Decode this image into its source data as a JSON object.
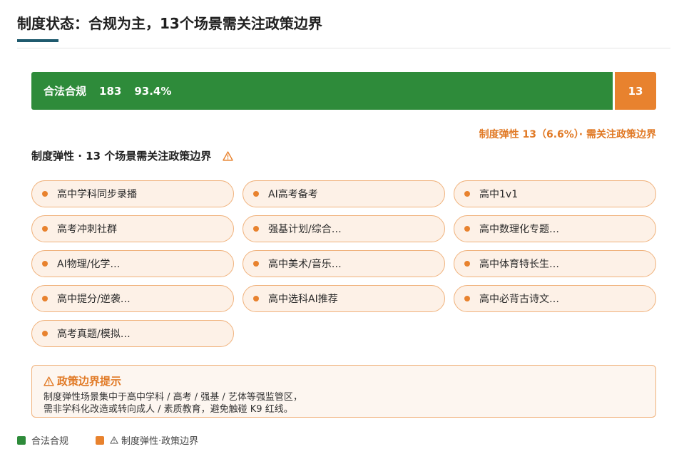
{
  "header": {
    "title": "制度状态：合规为主，13个场景需关注政策边界"
  },
  "status_bar": {
    "compliant_label": "合法合规",
    "compliant_count": "183",
    "compliant_pct": "93.4%",
    "flex_count": "13",
    "compliant_value": 183,
    "flex_value": 13,
    "compliant_color": "#2e8b3a",
    "flex_color": "#e8822e"
  },
  "flex_note": "制度弹性 13（6.6%）· 需关注政策边界",
  "section": {
    "heading": "制度弹性 · 13 个场景需关注政策边界",
    "icon": "warning-triangle-icon"
  },
  "chips": [
    {
      "label": "高中学科同步录播"
    },
    {
      "label": "AI高考备考"
    },
    {
      "label": "高中1v1"
    },
    {
      "label": "高考冲刺社群"
    },
    {
      "label": "强基计划/综合…"
    },
    {
      "label": "高中数理化专题…"
    },
    {
      "label": "AI物理/化学…"
    },
    {
      "label": "高中美术/音乐…"
    },
    {
      "label": "高中体育特长生…"
    },
    {
      "label": "高中提分/逆袭…"
    },
    {
      "label": "高中选科AI推荐"
    },
    {
      "label": "高中必背古诗文…"
    },
    {
      "label": "高考真题/模拟…"
    }
  ],
  "callout": {
    "title": "政策边界提示",
    "line1": "制度弹性场景集中于高中学科 / 高考 / 强基 / 艺体等强监管区，",
    "line2": "需非学科化改造或转向成人 / 素质教育，避免触碰 K9 红线。"
  },
  "legend": {
    "compliant": "合法合规",
    "flex": "制度弹性·政策边界"
  }
}
